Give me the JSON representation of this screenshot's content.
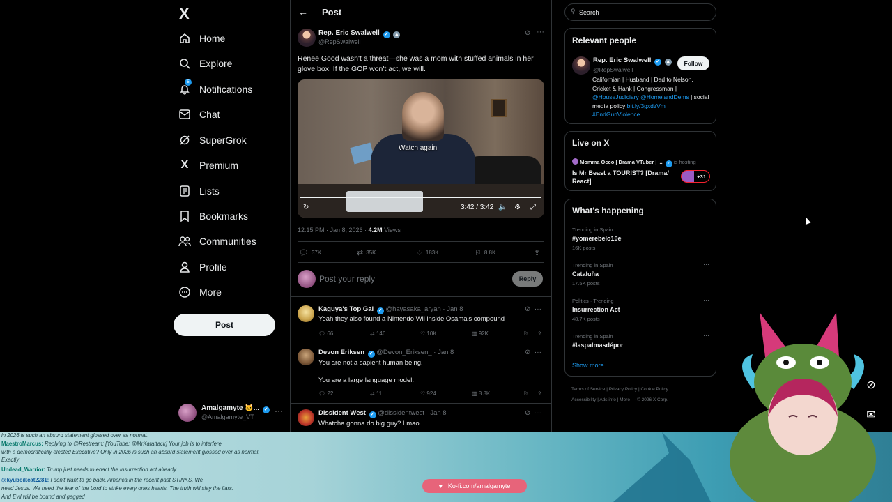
{
  "nav": {
    "logo": "X",
    "items": [
      {
        "label": "Home",
        "icon": "home-icon"
      },
      {
        "label": "Explore",
        "icon": "search-icon"
      },
      {
        "label": "Notifications",
        "icon": "bell-icon",
        "badge": "5"
      },
      {
        "label": "Chat",
        "icon": "mail-icon"
      },
      {
        "label": "SuperGrok",
        "icon": "grok-icon"
      },
      {
        "label": "Premium",
        "icon": "x-icon"
      },
      {
        "label": "Lists",
        "icon": "list-icon"
      },
      {
        "label": "Bookmarks",
        "icon": "bookmark-icon"
      },
      {
        "label": "Communities",
        "icon": "people-icon"
      },
      {
        "label": "Profile",
        "icon": "person-icon"
      },
      {
        "label": "More",
        "icon": "more-circle-icon"
      }
    ],
    "post_button": "Post",
    "account": {
      "name": "Amalgamyte 🐱...",
      "handle": "@Amalgamyte_VT"
    }
  },
  "main": {
    "header_title": "Post",
    "tweet": {
      "author": "Rep. Eric Swalwell",
      "handle": "@RepSwalwell",
      "text": "Renee Good wasn't a threat—she was a mom with stuffed animals in her glove box. If the GOP won't act, we will.",
      "video": {
        "overlay_text": "Watch again",
        "time": "3:42 / 3:42",
        "progress": 1.0
      },
      "timestamp": "12:15 PM · Jan 8, 2026 · ",
      "views_count": "4.2M",
      "views_label": " Views",
      "stats": {
        "replies": "37K",
        "reposts": "35K",
        "likes": "183K",
        "bookmarks": "8.8K"
      }
    },
    "reply_box": {
      "placeholder": "Post your reply",
      "button": "Reply"
    },
    "replies": [
      {
        "name": "Kaguya's Top Gal",
        "handle": "@hayasaka_aryan · Jan 8",
        "text": "Yeah they also found a Nintendo Wii inside Osama's compound",
        "text2": "",
        "replies": "66",
        "reposts": "146",
        "likes": "10K",
        "views": "92K"
      },
      {
        "name": "Devon Eriksen",
        "handle": "@Devon_Eriksen_ · Jan 8",
        "text": "You are not a sapient human being.",
        "text2": "You are a large language model.",
        "replies": "22",
        "reposts": "11",
        "likes": "924",
        "views": "8.8K"
      },
      {
        "name": "Dissident West",
        "handle": "@dissidentwest · Jan 8",
        "text": "Whatcha gonna do big guy? Lmao",
        "text2": ""
      }
    ]
  },
  "right": {
    "search_placeholder": "Search",
    "relevant_people": {
      "title": "Relevant people",
      "name": "Rep. Eric Swalwell",
      "handle": "@RepSwalwell",
      "follow": "Follow",
      "bio1": "Californian | Husband | Dad to Nelson, Cricket & Hank | Congressman |",
      "bio_link1": "@HouseJudiciary",
      "bio_link2": "@HomelandDems",
      "bio2": " | social media policy:",
      "bio_link3": "bit.ly/3gxdzVm",
      "bio3": " |",
      "bio_link4": "#EndGunViolence"
    },
    "live": {
      "title": "Live on X",
      "host": "Momma Occo | Drama VTuber | ...",
      "hosting": "is hosting",
      "stream_title": "Is Mr Beast a TOURIST? [Drama/ React]",
      "viewers": "+31"
    },
    "happening": {
      "title": "What's happening",
      "trends": [
        {
          "context": "Trending in Spain",
          "topic": "#yomerebelo10e",
          "posts": "16K posts"
        },
        {
          "context": "Trending in Spain",
          "topic": "Cataluña",
          "posts": "17.5K posts"
        },
        {
          "context": "Politics · Trending",
          "topic": "Insurrection Act",
          "posts": "48.7K posts"
        },
        {
          "context": "Trending in Spain",
          "topic": "#laspalmasdépor",
          "posts": ""
        }
      ],
      "show_more": "Show more"
    },
    "footer1": "Terms of Service  |  Privacy Policy  |  Cookie Policy  |",
    "footer2": "Accessibility  |  Ads info  |  More ···  © 2026 X Corp."
  },
  "overlay": {
    "chat": [
      {
        "name": "",
        "text": "in 2026 is such an absurd statement glossed over as normal."
      },
      {
        "name": "MaestroMarcus:",
        "text": " Replying to @Restream: [YouTube: @MrKatattack] Your job is to interfere"
      },
      {
        "name": "",
        "text": "with a democratically elected Executive? Only in 2026 is such an absurd statement glossed over as normal."
      },
      {
        "name": "",
        "text": "Exactly"
      },
      {
        "name": "Undead_Warrior:",
        "text": " Trump just needs to enact the Insurrection act already"
      },
      {
        "name": "@kyubbikcat2281:",
        "text": " I don't want to go back. America in the recent past STINKS. We"
      },
      {
        "name": "",
        "text": "need Jesus. We need the fear of the Lord to strike every ones hearts. The truth will slay the liars."
      },
      {
        "name": "",
        "text": "And Evil will be bound and gagged"
      }
    ],
    "kofi": "Ko-fi.com/amalgamyte"
  }
}
